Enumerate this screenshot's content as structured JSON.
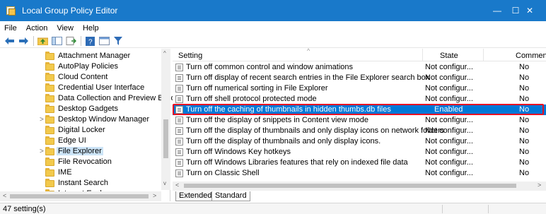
{
  "window": {
    "title": "Local Group Policy Editor",
    "minimize": "—",
    "maximize": "☐",
    "close": "✕"
  },
  "menu": [
    "File",
    "Action",
    "View",
    "Help"
  ],
  "toolbar": {
    "icons": [
      "back-arrow-icon",
      "forward-arrow-icon",
      "folder-up-icon",
      "show-hide-tree-icon",
      "export-list-icon",
      "help-icon",
      "properties-icon",
      "filter-icon"
    ]
  },
  "tree": {
    "items": [
      {
        "label": "Attachment Manager",
        "expandable": false
      },
      {
        "label": "AutoPlay Policies",
        "expandable": false
      },
      {
        "label": "Cloud Content",
        "expandable": false
      },
      {
        "label": "Credential User Interface",
        "expandable": false
      },
      {
        "label": "Data Collection and Preview Builds",
        "expandable": false
      },
      {
        "label": "Desktop Gadgets",
        "expandable": false
      },
      {
        "label": "Desktop Window Manager",
        "expandable": true
      },
      {
        "label": "Digital Locker",
        "expandable": false
      },
      {
        "label": "Edge UI",
        "expandable": false
      },
      {
        "label": "File Explorer",
        "expandable": true,
        "selected": true
      },
      {
        "label": "File Revocation",
        "expandable": false
      },
      {
        "label": "IME",
        "expandable": false
      },
      {
        "label": "Instant Search",
        "expandable": false
      },
      {
        "label": "Internet Explorer",
        "expandable": true
      }
    ],
    "scroll": {
      "up": "^",
      "down": "v",
      "left": "<",
      "right": ">"
    }
  },
  "list": {
    "headers": {
      "setting": "Setting",
      "state": "State",
      "comment": "Comment",
      "sort_indicator": "^"
    },
    "rows": [
      {
        "setting": "Turn off common control and window animations",
        "state": "Not configur...",
        "comment": "No"
      },
      {
        "setting": "Turn off display of recent search entries in the File Explorer search box",
        "state": "Not configur...",
        "comment": "No"
      },
      {
        "setting": "Turn off numerical sorting in File Explorer",
        "state": "Not configur...",
        "comment": "No"
      },
      {
        "setting": "Turn off shell protocol protected mode",
        "state": "Not configur...",
        "comment": "No"
      },
      {
        "setting": "Turn off the caching of thumbnails in hidden thumbs.db files",
        "state": "Enabled",
        "comment": "No",
        "selected": true
      },
      {
        "setting": "Turn off the display of snippets in Content view mode",
        "state": "Not configur...",
        "comment": "No"
      },
      {
        "setting": "Turn off the display of thumbnails and only display icons on network folders",
        "state": "Not configur...",
        "comment": "No"
      },
      {
        "setting": "Turn off the display of thumbnails and only display icons.",
        "state": "Not configur...",
        "comment": "No"
      },
      {
        "setting": "Turn off Windows Key hotkeys",
        "state": "Not configur...",
        "comment": "No"
      },
      {
        "setting": "Turn off Windows Libraries features that rely on indexed file data",
        "state": "Not configur...",
        "comment": "No"
      },
      {
        "setting": "Turn on Classic Shell",
        "state": "Not configur...",
        "comment": "No"
      }
    ],
    "scroll": {
      "left": "<",
      "right": ">"
    }
  },
  "tabs": [
    "Extended",
    "Standard"
  ],
  "status": {
    "text": "47 setting(s)"
  },
  "colors": {
    "title_bar": "#1979ca",
    "selection": "#0078d7",
    "highlight_outline": "#e81123",
    "folder": "#f2c94c"
  }
}
